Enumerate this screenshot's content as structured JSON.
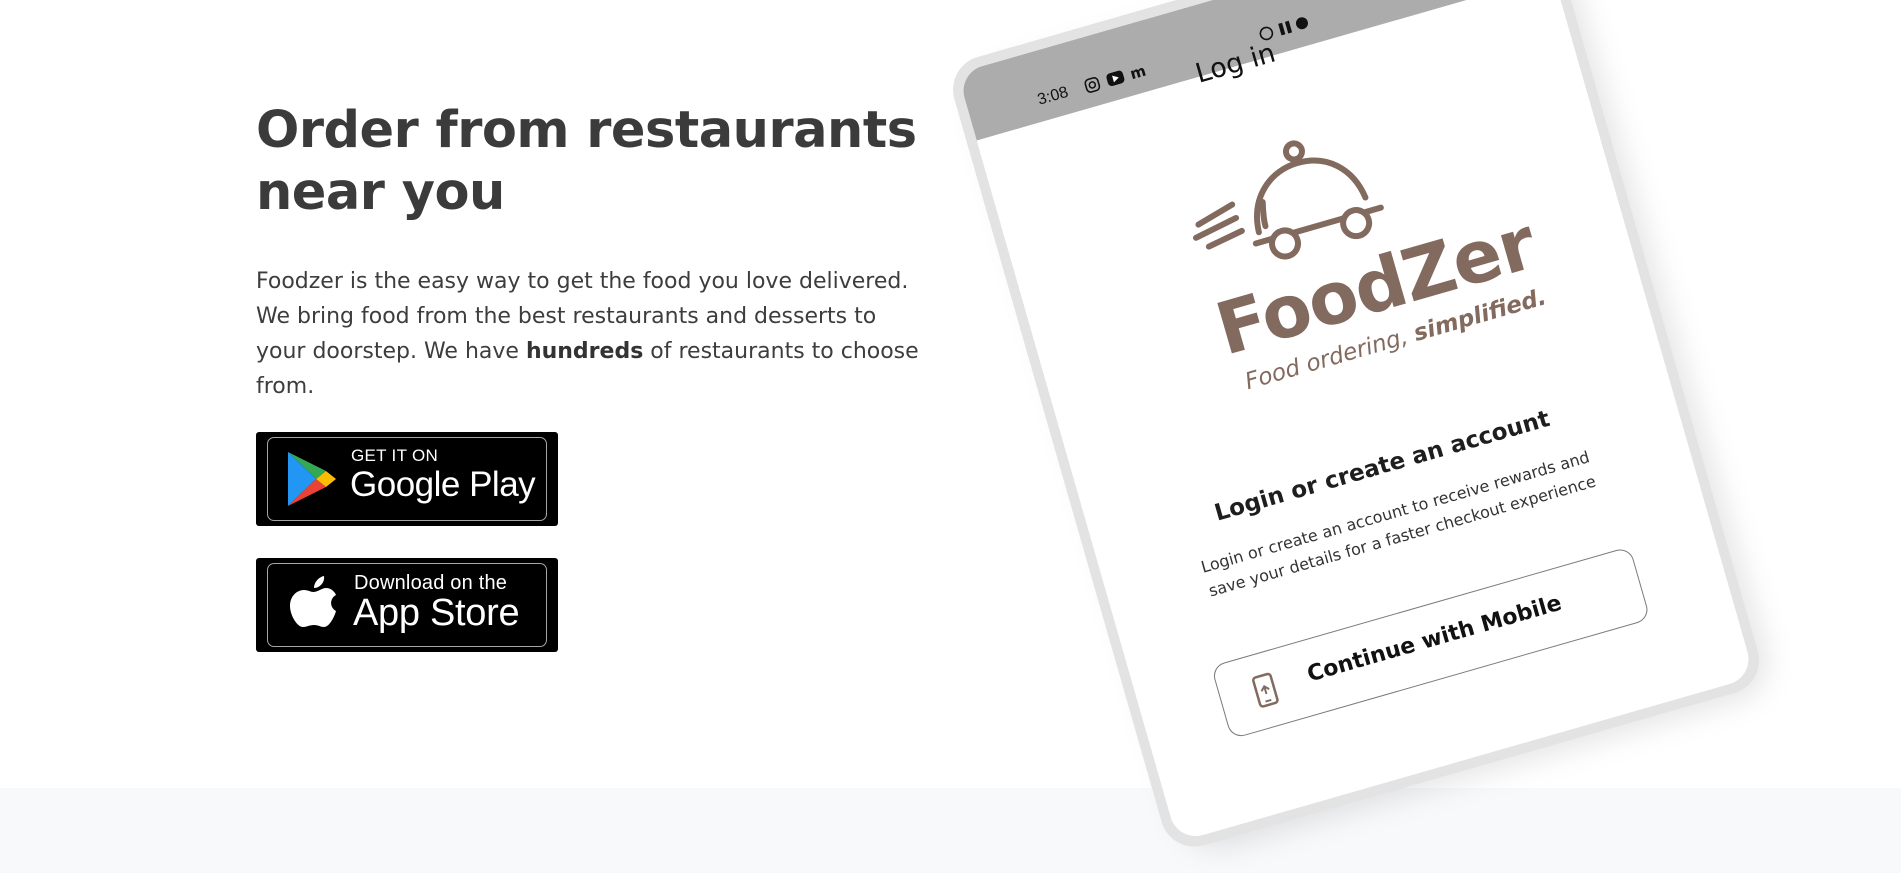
{
  "hero": {
    "title": "Order from restaurants near you",
    "desc_part1": "Foodzer is the easy way to get the food you love delivered. We bring food from the best restaurants and desserts to your doorstep. We have ",
    "desc_bold": "hundreds",
    "desc_part2": " of restaurants to choose from."
  },
  "badges": {
    "google_small": "GET IT ON",
    "google_big": "Google Play",
    "apple_small": "Download on the",
    "apple_big": "App Store"
  },
  "phone": {
    "status_time": "3:08",
    "screen_title": "Log in",
    "brand_name": "FoodZer",
    "tagline_regular": "Food ordering, ",
    "tagline_bold": "simplified.",
    "login_heading": "Login or create an account",
    "login_subtext": "Login or create an account to receive rewards and save your details for a faster checkout experience",
    "mobile_button_label": "Continue with Mobile"
  },
  "colors": {
    "brand": "#836a5f",
    "heading": "#3b3b3b",
    "footer_band": "#f8f9fb"
  }
}
